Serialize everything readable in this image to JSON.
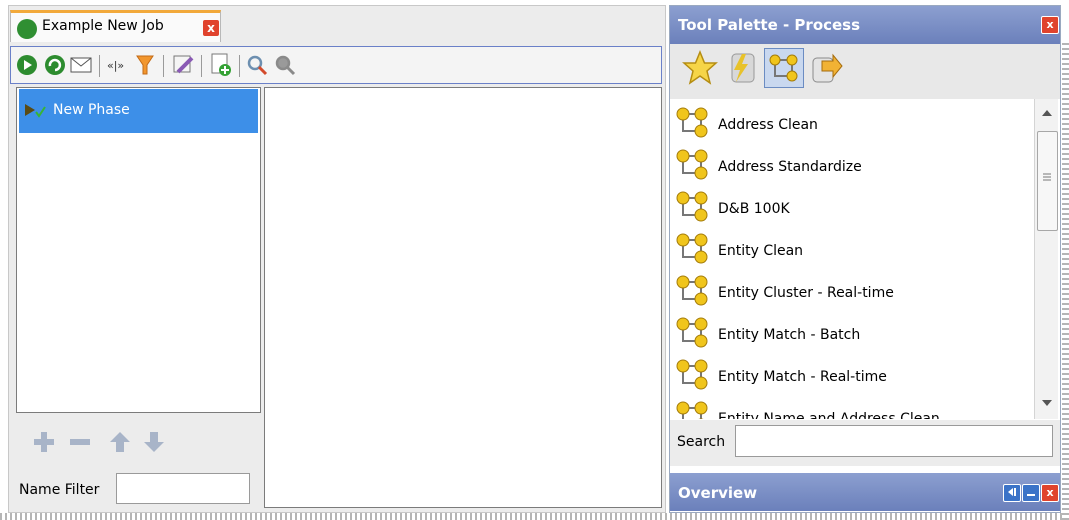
{
  "editor": {
    "tab": {
      "title": "Example New Job",
      "close": "x"
    },
    "toolbar": {
      "icons": [
        "run-icon",
        "refresh-icon",
        "mail-icon",
        "split-icon",
        "filter-icon",
        "edit-icon",
        "new-document-icon",
        "search-icon",
        "search-disabled-icon"
      ]
    },
    "phases": [
      {
        "label": "New Phase"
      }
    ],
    "name_filter": {
      "label": "Name Filter",
      "value": ""
    }
  },
  "palette": {
    "title": "Tool Palette - Process",
    "close": "x",
    "items": [
      {
        "label": "Address Clean"
      },
      {
        "label": "Address Standardize"
      },
      {
        "label": "D&B 100K"
      },
      {
        "label": "Entity Clean"
      },
      {
        "label": "Entity Cluster - Real-time"
      },
      {
        "label": "Entity Match - Batch"
      },
      {
        "label": "Entity Match - Real-time"
      },
      {
        "label": "Entity Name and Address Clean"
      }
    ],
    "search": {
      "label": "Search",
      "value": ""
    }
  },
  "overview": {
    "title": "Overview",
    "close": "x"
  },
  "colors": {
    "accent": "#3d8fe8",
    "header": "#7a8ec6",
    "close": "#e0432d"
  }
}
